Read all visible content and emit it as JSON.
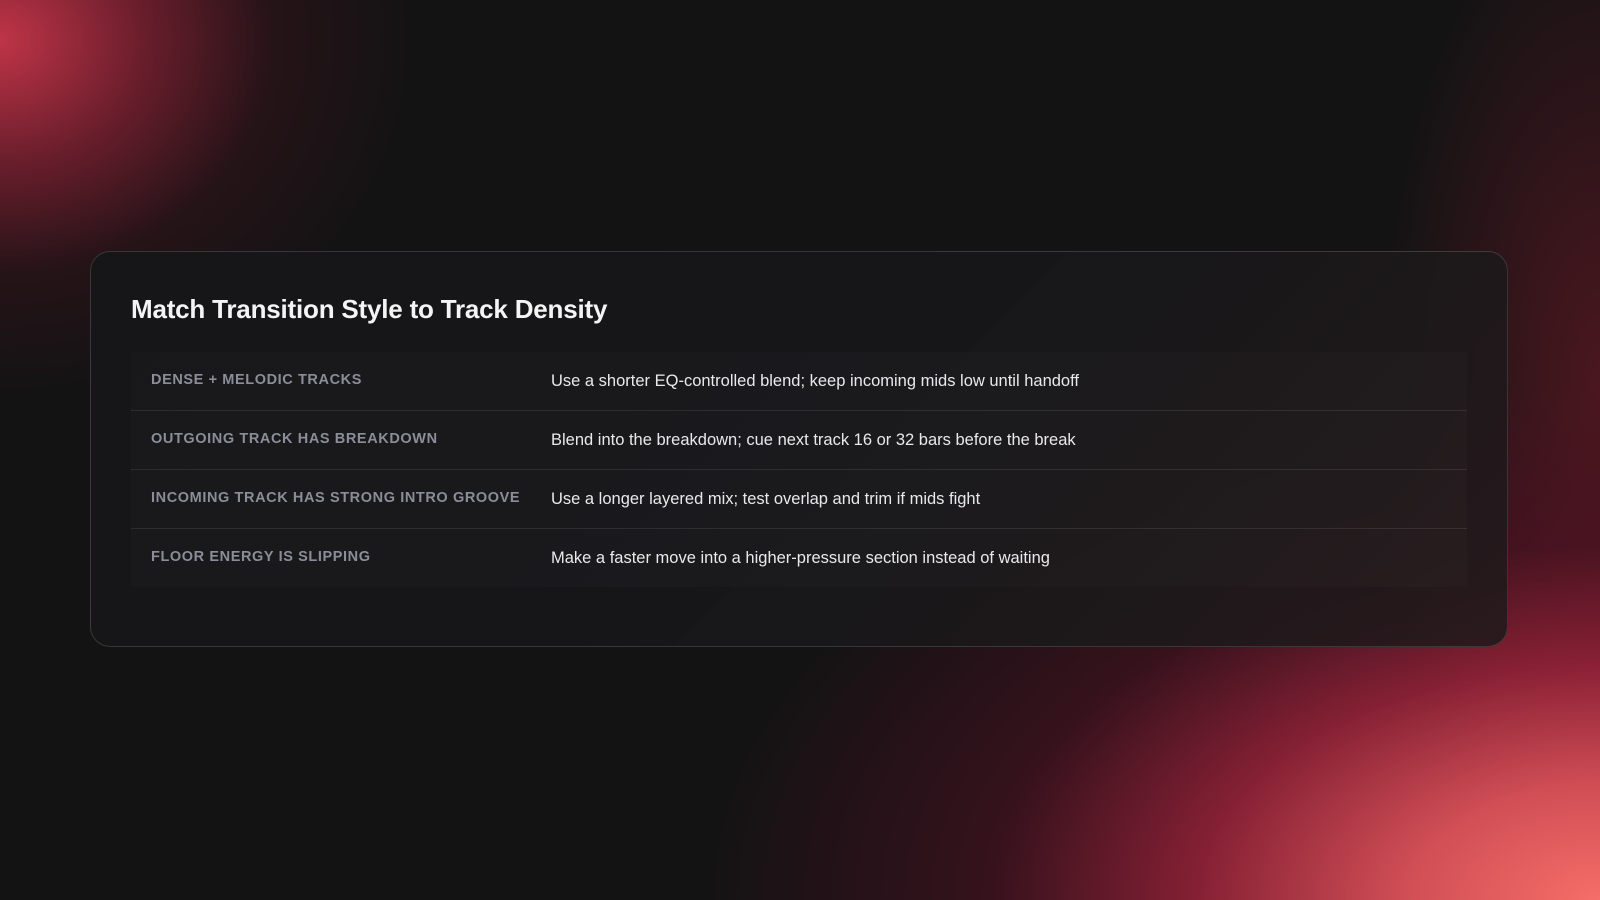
{
  "card": {
    "title": "Match Transition Style to Track Density",
    "rows": [
      {
        "label": "DENSE + MELODIC TRACKS",
        "value": "Use a shorter EQ-controlled blend; keep incoming mids low until handoff"
      },
      {
        "label": "OUTGOING TRACK HAS BREAKDOWN",
        "value": "Blend into the breakdown; cue next track 16 or 32 bars before the break"
      },
      {
        "label": "INCOMING TRACK HAS STRONG INTRO GROOVE",
        "value": "Use a longer layered mix; test overlap and trim if mids fight"
      },
      {
        "label": "FLOOR ENERGY IS SLIPPING",
        "value": "Make a faster move into a higher-pressure section instead of waiting"
      }
    ]
  },
  "colors": {
    "background": "#131314",
    "accent_top_left": "#c8364a",
    "accent_bottom_right": "#f66e68",
    "label_text": "#8b8d99",
    "value_text": "#e9e9ec",
    "title_text": "#f4f4f5"
  }
}
